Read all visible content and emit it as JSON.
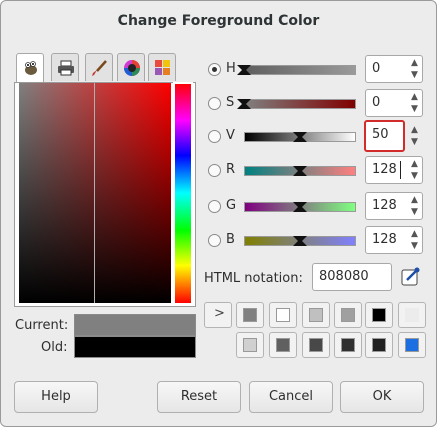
{
  "dialog": {
    "title": "Change Foreground Color"
  },
  "tabs": [
    {
      "icon": "gimp-wilber-icon",
      "active": true
    },
    {
      "icon": "printer-icon",
      "active": false
    },
    {
      "icon": "paintbrush-icon",
      "active": false
    },
    {
      "icon": "color-wheel-icon",
      "active": false
    },
    {
      "icon": "palette-icon",
      "active": false
    }
  ],
  "colors": {
    "current_label": "Current:",
    "old_label": "Old:",
    "current": "#808080",
    "old": "#000000"
  },
  "channels": [
    {
      "label": "H",
      "value": "0",
      "selected": true,
      "level": 0.0
    },
    {
      "label": "S",
      "value": "0",
      "selected": false,
      "level": 0.0
    },
    {
      "label": "V",
      "value": "50",
      "selected": false,
      "level": 0.5,
      "highlighted": true
    },
    {
      "label": "R",
      "value": "128",
      "selected": false,
      "level": 0.5,
      "cursor": true
    },
    {
      "label": "G",
      "value": "128",
      "selected": false,
      "level": 0.5
    },
    {
      "label": "B",
      "value": "128",
      "selected": false,
      "level": 0.5
    }
  ],
  "html_notation": {
    "label": "HTML notation:",
    "value": "808080"
  },
  "history": {
    "expand_icon": "chevron-right-icon",
    "row1": [
      "#808080",
      "#ffffff",
      "#c0c0c0",
      "#a0a0a0",
      "#000000",
      "#ececec"
    ],
    "row2": [
      "#d0d0d0",
      "#606060",
      "#484848",
      "#303030",
      "#202020",
      "#1b6fe0"
    ]
  },
  "buttons": {
    "help": "Help",
    "reset": "Reset",
    "cancel": "Cancel",
    "ok": "OK"
  }
}
